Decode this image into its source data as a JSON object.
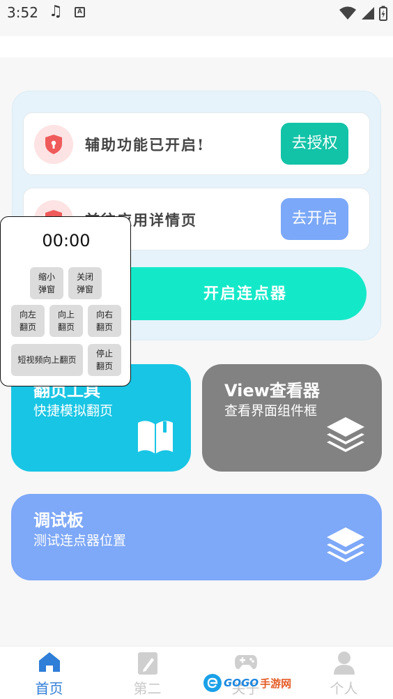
{
  "status_bar": {
    "time": "3:52",
    "music_icon": "♫"
  },
  "panel": {
    "row1": {
      "text": "辅助功能已开启!",
      "button": "去授权",
      "icon": "shield-icon"
    },
    "row2": {
      "text": "前往应用详情页",
      "button": "去开启",
      "icon": "shield-icon"
    },
    "start_button": "开启连点器"
  },
  "tiles": {
    "page_turn": {
      "title": "翻页工具",
      "subtitle": "快捷模拟翻页",
      "icon": "book-icon"
    },
    "view": {
      "title": "View查看器",
      "subtitle": "查看界面组件框",
      "icon": "layers-icon"
    },
    "debug": {
      "title": "调试板",
      "subtitle": "测试连点器位置",
      "icon": "layers-icon"
    }
  },
  "float_window": {
    "timer": "00:00",
    "buttons": {
      "shrink": [
        "缩小",
        "弹窗"
      ],
      "close": [
        "关闭",
        "弹窗"
      ],
      "left": [
        "向左",
        "翻页"
      ],
      "up": [
        "向上",
        "翻页"
      ],
      "right": [
        "向右",
        "翻页"
      ],
      "short_video": "短视频向上翻页",
      "stop": [
        "停止",
        "翻页"
      ]
    }
  },
  "bottom_nav": {
    "items": [
      {
        "label": "首页",
        "icon": "home-icon",
        "active": true
      },
      {
        "label": "第二",
        "icon": "edit-icon",
        "active": false
      },
      {
        "label": "关于",
        "icon": "gamepad-icon",
        "active": false
      },
      {
        "label": "个人",
        "icon": "person-icon",
        "active": false
      }
    ]
  },
  "watermark": {
    "brand": "GOGO",
    "suffix": "手游网"
  },
  "colors": {
    "teal": "#12c3a7",
    "blue": "#7ba8f8",
    "mint": "#13e9c8",
    "cyan": "#18c5e4",
    "gray": "#828282",
    "active_nav": "#2f7ed8"
  }
}
